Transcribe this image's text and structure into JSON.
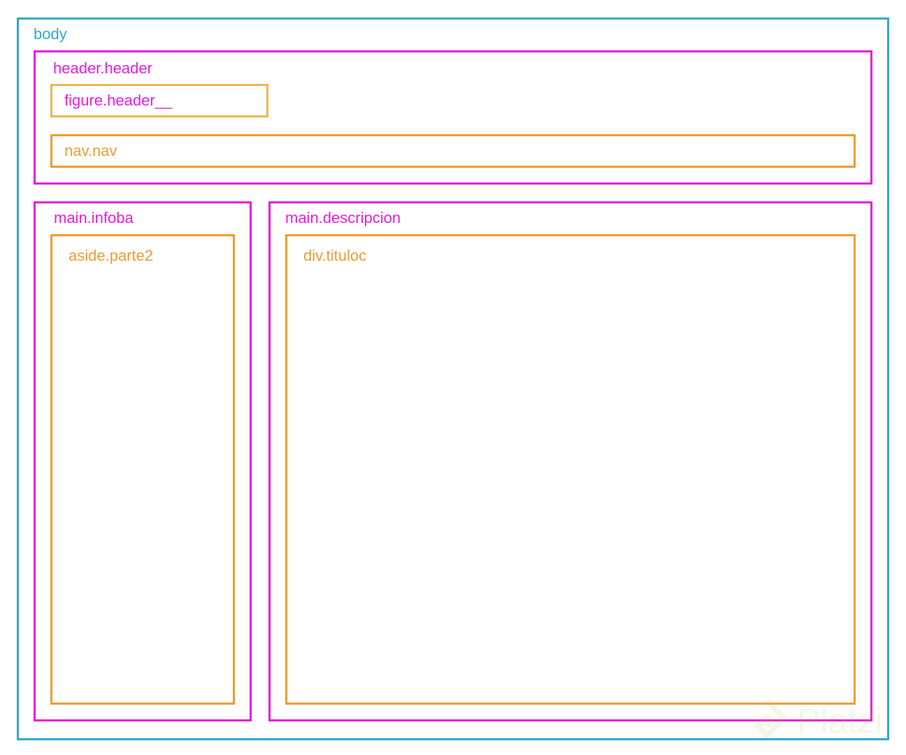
{
  "colors": {
    "body_border": "#2ea7cf",
    "section_border": "#e619dc",
    "element_border": "#ef9a2e",
    "figure_border": "#f0b44c",
    "watermark": "#98ca3f"
  },
  "labels": {
    "body": "body",
    "header": "header.header",
    "figure": "figure.header__",
    "nav": "nav.nav",
    "infoba": "main.infoba",
    "aside": "aside.parte2",
    "descripcion": "main.descripcion",
    "tituloc": "div.tituloc"
  },
  "watermark": {
    "icon": "platzi-logo-icon",
    "text": "Platzi"
  }
}
